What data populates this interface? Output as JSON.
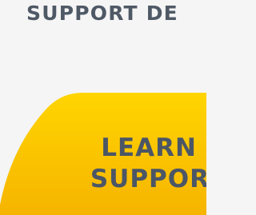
{
  "section": {
    "heading": "SUPPORT DE"
  },
  "cta": {
    "title_line_1": "LEARN",
    "title_line_2": "SUPPOR"
  },
  "colors": {
    "background": "#f5f5f5",
    "text": "#4f5966",
    "card_yellow_light": "#ffd500",
    "card_yellow_dark": "#f6b400"
  }
}
